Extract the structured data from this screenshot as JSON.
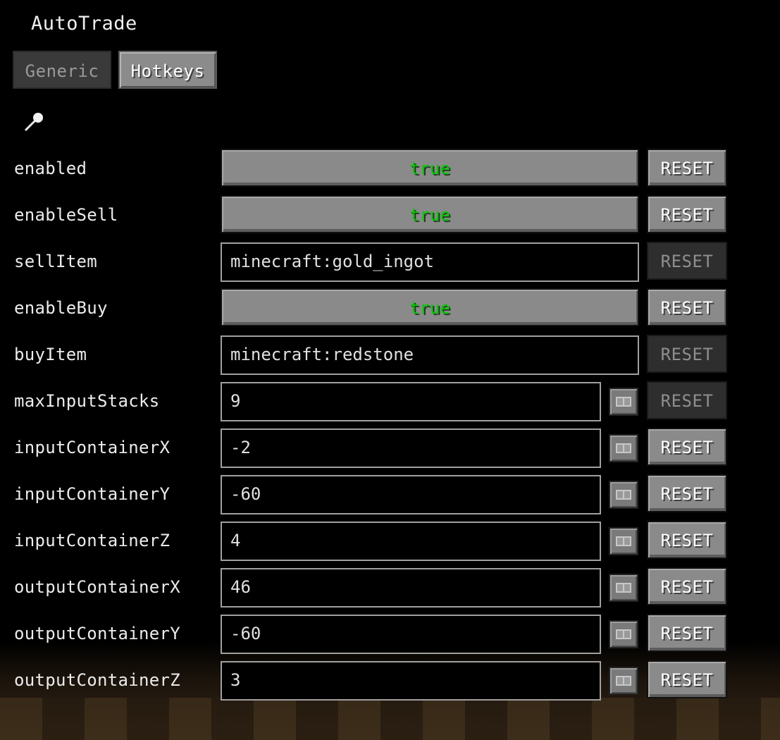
{
  "title": "AutoTrade",
  "tabs": {
    "generic": "Generic",
    "hotkeys": "Hotkeys"
  },
  "reset_label": "RESET",
  "icons": {
    "search": "search-icon",
    "picker": "coordinate-picker-icon"
  },
  "rows": [
    {
      "label": "enabled",
      "type": "toggle",
      "value": "true",
      "reset_enabled": true
    },
    {
      "label": "enableSell",
      "type": "toggle",
      "value": "true",
      "reset_enabled": true
    },
    {
      "label": "sellItem",
      "type": "text",
      "value": "minecraft:gold_ingot",
      "reset_enabled": false
    },
    {
      "label": "enableBuy",
      "type": "toggle",
      "value": "true",
      "reset_enabled": true
    },
    {
      "label": "buyItem",
      "type": "text",
      "value": "minecraft:redstone",
      "reset_enabled": false
    },
    {
      "label": "maxInputStacks",
      "type": "number",
      "value": "9",
      "reset_enabled": false
    },
    {
      "label": "inputContainerX",
      "type": "number",
      "value": "-2",
      "reset_enabled": true
    },
    {
      "label": "inputContainerY",
      "type": "number",
      "value": "-60",
      "reset_enabled": true
    },
    {
      "label": "inputContainerZ",
      "type": "number",
      "value": "4",
      "reset_enabled": true
    },
    {
      "label": "outputContainerX",
      "type": "number",
      "value": "46",
      "reset_enabled": true
    },
    {
      "label": "outputContainerY",
      "type": "number",
      "value": "-60",
      "reset_enabled": true
    },
    {
      "label": "outputContainerZ",
      "type": "number",
      "value": "3",
      "reset_enabled": true
    }
  ],
  "colors": {
    "toggle_true": "#00c800",
    "button_face": "#8a8a8a",
    "disabled_face": "#2e2e2e",
    "background": "#000000"
  }
}
